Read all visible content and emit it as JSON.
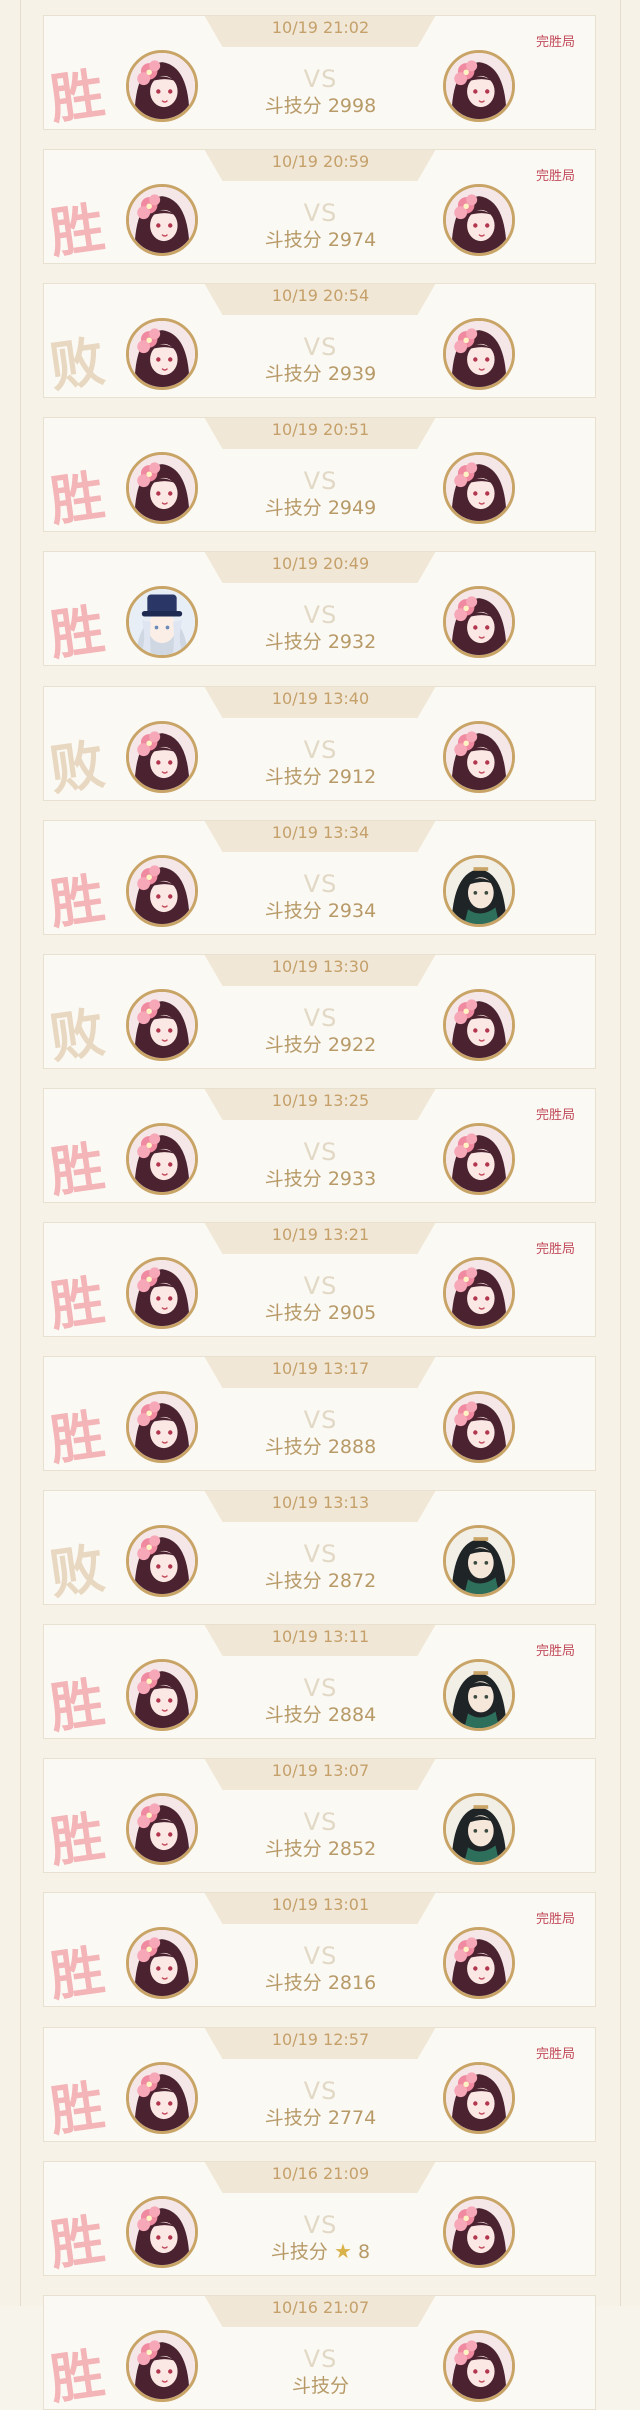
{
  "colors": {
    "accent_gold": "#c9a467",
    "win": "#f2a2a6",
    "loss": "#e6d5bc",
    "perfect": "#c24b5a"
  },
  "score_label": "斗技分",
  "vs_label": "VS",
  "perfect_label": "完胜局",
  "matches": [
    {
      "time": "10/19 21:02",
      "score": "2998",
      "result": "win",
      "result_text": "胜",
      "perfect": true,
      "left_avatar": "shikigami-pink-flower",
      "right_avatar": "shikigami-pink-flower"
    },
    {
      "time": "10/19 20:59",
      "score": "2974",
      "result": "win",
      "result_text": "胜",
      "perfect": true,
      "left_avatar": "shikigami-pink-flower",
      "right_avatar": "shikigami-pink-flower"
    },
    {
      "time": "10/19 20:54",
      "score": "2939",
      "result": "loss",
      "result_text": "败",
      "perfect": false,
      "left_avatar": "shikigami-pink-flower",
      "right_avatar": "shikigami-pink-flower"
    },
    {
      "time": "10/19 20:51",
      "score": "2949",
      "result": "win",
      "result_text": "胜",
      "perfect": false,
      "left_avatar": "shikigami-pink-flower",
      "right_avatar": "shikigami-pink-flower"
    },
    {
      "time": "10/19 20:49",
      "score": "2932",
      "result": "win",
      "result_text": "胜",
      "perfect": false,
      "left_avatar": "shikigami-white-hair-hat",
      "right_avatar": "shikigami-pink-flower"
    },
    {
      "time": "10/19 13:40",
      "score": "2912",
      "result": "loss",
      "result_text": "败",
      "perfect": false,
      "left_avatar": "shikigami-pink-flower",
      "right_avatar": "shikigami-pink-flower"
    },
    {
      "time": "10/19 13:34",
      "score": "2934",
      "result": "win",
      "result_text": "胜",
      "perfect": false,
      "left_avatar": "shikigami-pink-flower",
      "right_avatar": "shikigami-dark-hair-green"
    },
    {
      "time": "10/19 13:30",
      "score": "2922",
      "result": "loss",
      "result_text": "败",
      "perfect": false,
      "left_avatar": "shikigami-pink-flower",
      "right_avatar": "shikigami-pink-flower"
    },
    {
      "time": "10/19 13:25",
      "score": "2933",
      "result": "win",
      "result_text": "胜",
      "perfect": true,
      "left_avatar": "shikigami-pink-flower",
      "right_avatar": "shikigami-pink-flower"
    },
    {
      "time": "10/19 13:21",
      "score": "2905",
      "result": "win",
      "result_text": "胜",
      "perfect": true,
      "left_avatar": "shikigami-pink-flower",
      "right_avatar": "shikigami-pink-flower"
    },
    {
      "time": "10/19 13:17",
      "score": "2888",
      "result": "win",
      "result_text": "胜",
      "perfect": false,
      "left_avatar": "shikigami-pink-flower",
      "right_avatar": "shikigami-pink-flower"
    },
    {
      "time": "10/19 13:13",
      "score": "2872",
      "result": "loss",
      "result_text": "败",
      "perfect": false,
      "left_avatar": "shikigami-pink-flower",
      "right_avatar": "shikigami-dark-hair-green"
    },
    {
      "time": "10/19 13:11",
      "score": "2884",
      "result": "win",
      "result_text": "胜",
      "perfect": true,
      "left_avatar": "shikigami-pink-flower",
      "right_avatar": "shikigami-dark-hair-green"
    },
    {
      "time": "10/19 13:07",
      "score": "2852",
      "result": "win",
      "result_text": "胜",
      "perfect": false,
      "left_avatar": "shikigami-pink-flower",
      "right_avatar": "shikigami-dark-hair-green"
    },
    {
      "time": "10/19 13:01",
      "score": "2816",
      "result": "win",
      "result_text": "胜",
      "perfect": true,
      "left_avatar": "shikigami-pink-flower",
      "right_avatar": "shikigami-pink-flower"
    },
    {
      "time": "10/19 12:57",
      "score": "2774",
      "result": "win",
      "result_text": "胜",
      "perfect": true,
      "left_avatar": "shikigami-pink-flower",
      "right_avatar": "shikigami-pink-flower"
    },
    {
      "time": "10/16 21:09",
      "score": "8",
      "score_star": true,
      "result": "win",
      "result_text": "胜",
      "perfect": false,
      "left_avatar": "shikigami-pink-flower",
      "right_avatar": "shikigami-pink-flower"
    },
    {
      "time": "10/16 21:07",
      "score": "",
      "result": "win",
      "result_text": "胜",
      "perfect": false,
      "left_avatar": "shikigami-pink-flower",
      "right_avatar": "shikigami-pink-flower"
    }
  ]
}
